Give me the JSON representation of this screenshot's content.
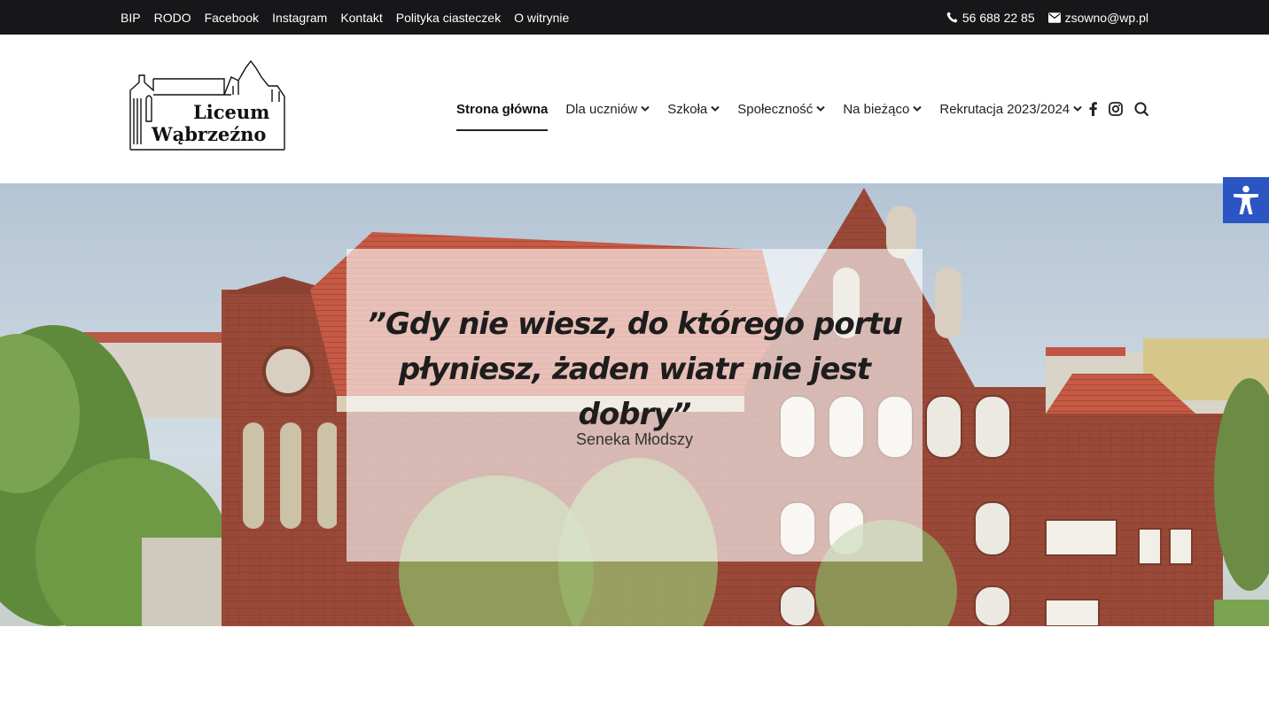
{
  "topbar": {
    "links": [
      "BIP",
      "RODO",
      "Facebook",
      "Instagram",
      "Kontakt",
      "Polityka ciasteczek",
      "O witrynie"
    ],
    "phone": "56 688 22 85",
    "email": "zsowno@wp.pl"
  },
  "logo": {
    "line1": "Liceum",
    "line2": "Wąbrzeźno"
  },
  "nav": {
    "items": [
      {
        "label": "Strona główna",
        "dropdown": false,
        "active": true
      },
      {
        "label": "Dla uczniów",
        "dropdown": true
      },
      {
        "label": "Szkoła",
        "dropdown": true
      },
      {
        "label": "Społeczność",
        "dropdown": true
      },
      {
        "label": "Na bieżąco",
        "dropdown": true
      },
      {
        "label": "Rekrutacja 2023/2024",
        "dropdown": true
      }
    ],
    "icons": [
      "facebook-icon",
      "instagram-icon",
      "search-icon"
    ]
  },
  "hero": {
    "quote_line1": "”Gdy nie wiesz, do którego portu",
    "quote_line2": "płyniesz, żaden wiatr nie jest dobry”",
    "author": "Seneka Młodszy"
  },
  "colors": {
    "topbar_bg": "#171719",
    "accessibility_bg": "#2b55c2",
    "brick": "#9c4a3a",
    "roof": "#c8553e"
  }
}
